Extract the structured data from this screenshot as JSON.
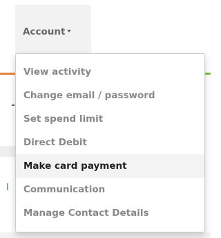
{
  "account_menu": {
    "toggle_label": "Account",
    "toggle_icon": "caret-down-icon",
    "items": [
      {
        "label": "View activity",
        "active": false
      },
      {
        "label": "Change email / password",
        "active": false
      },
      {
        "label": "Set spend limit",
        "active": false
      },
      {
        "label": "Direct Debit",
        "active": false
      },
      {
        "label": "Make card payment",
        "active": true
      },
      {
        "label": "Communication",
        "active": false
      },
      {
        "label": "Manage Contact Details",
        "active": false
      }
    ]
  },
  "background": {
    "partial_text": "I"
  },
  "colors": {
    "item_text": "#888888",
    "active_text": "#222222",
    "active_bg": "#f3f3f3",
    "toggle_bg": "#f2f2f2",
    "orange_accent": "#e8823a",
    "green_accent": "#7fbf3f",
    "link_blue": "#2a7ec0"
  }
}
